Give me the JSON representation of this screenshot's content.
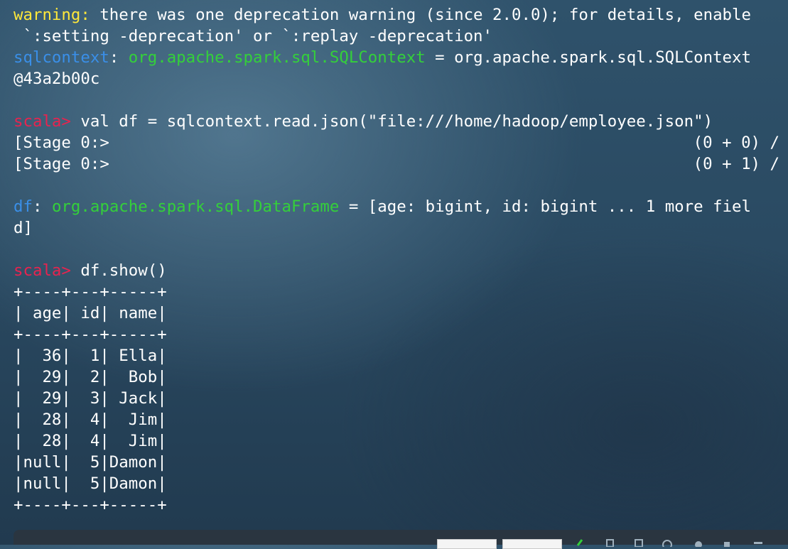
{
  "terminal": {
    "warning_prefix": "warning:",
    "warning_text": " there was one deprecation warning (since 2.0.0); for details, enable",
    "warning_cont": " `:setting -deprecation' or `:replay -deprecation'",
    "ctx_name": "sqlcontext",
    "ctx_sep": ": ",
    "ctx_type": "org.apache.spark.sql.SQLContext",
    "ctx_eq": " = org.apache.spark.sql.SQLContext",
    "ctx_addr": "@43a2b00c",
    "prompt": "scala>",
    "cmd1": " val df = sqlcontext.read.json(\"file:///home/hadoop/employee.json\")",
    "stage1_left": "[Stage 0:>",
    "stage1_right": "(0 + 0) /",
    "stage2_left": "[Stage 0:>",
    "stage2_right": "(0 + 1) /",
    "df_name": "df",
    "df_sep": ": ",
    "df_type": "org.apache.spark.sql.DataFrame",
    "df_eq": " = [age: bigint, id: bigint ... 1 more fiel",
    "df_cont": "d]",
    "cmd2": " df.show()",
    "table_border": "+----+---+-----+",
    "table_header": "| age| id| name|",
    "table_rows": [
      "|  36|  1| Ella|",
      "|  29|  2|  Bob|",
      "|  29|  3| Jack|",
      "|  28|  4|  Jim|",
      "|  28|  4|  Jim|",
      "|null|  5|Damon|",
      "|null|  5|Damon|"
    ]
  },
  "colors": {
    "warning": "#ffe83a",
    "identifier": "#3a8fe8",
    "type": "#34d03a",
    "prompt": "#e8234f",
    "text": "#ffffff"
  }
}
